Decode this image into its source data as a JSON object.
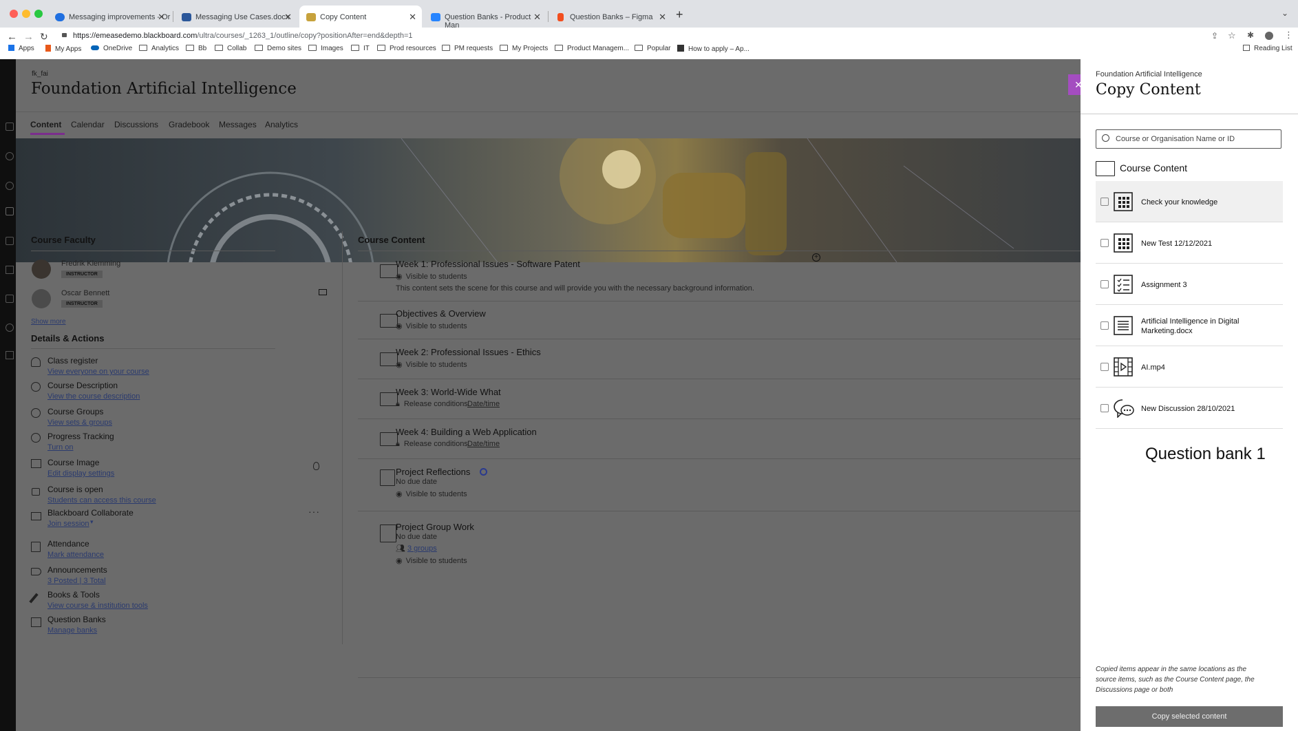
{
  "browser": {
    "tabs": [
      {
        "title": "Messaging improvements - Or",
        "color": "#1f6fe0"
      },
      {
        "title": "Messaging Use Cases.docx",
        "color": "#2b579a"
      },
      {
        "title": "Copy Content",
        "color": "#c7a23c"
      },
      {
        "title": "Question Banks - Product Man",
        "color": "#2684ff"
      },
      {
        "title": "Question Banks – Figma",
        "color": "#f24e1e"
      }
    ],
    "url_host": "https://emeasedemo.blackboard.com",
    "url_path": "/ultra/courses/_1263_1/outline/copy?positionAfter=end&depth=1",
    "bookmarks": [
      "Apps",
      "My Apps",
      "OneDrive",
      "Analytics",
      "Bb",
      "Collab",
      "Demo sites",
      "Images",
      "IT",
      "Prod resources",
      "PM requests",
      "My Projects",
      "Product Managem...",
      "Popular",
      "How to apply – Ap..."
    ],
    "reading_list": "Reading List"
  },
  "course": {
    "code": "fk_fai",
    "title": "Foundation Artificial Intelligence",
    "nav": [
      "Content",
      "Calendar",
      "Discussions",
      "Gradebook",
      "Messages",
      "Analytics"
    ]
  },
  "faculty": {
    "heading": "Course Faculty",
    "members": [
      {
        "name": "Fredrik Klemming",
        "role": "INSTRUCTOR"
      },
      {
        "name": "Oscar Bennett",
        "role": "INSTRUCTOR"
      }
    ],
    "show_more": "Show more"
  },
  "details": {
    "heading": "Details & Actions",
    "items": [
      {
        "label": "Class register",
        "link": "View everyone on your course",
        "icon": "people-icon"
      },
      {
        "label": "Course Description",
        "link": "View the course description",
        "icon": "info-icon"
      },
      {
        "label": "Course Groups",
        "link": "View sets & groups",
        "icon": "groups-icon"
      },
      {
        "label": "Progress Tracking",
        "link": "Turn on",
        "icon": "check-circle-icon"
      },
      {
        "label": "Course Image",
        "link": "Edit display settings",
        "icon": "image-icon"
      },
      {
        "label": "Course is open",
        "link": "Students can access this course",
        "icon": "unlock-icon"
      },
      {
        "label": "Blackboard Collaborate",
        "link": "Join session",
        "icon": "video-icon"
      },
      {
        "label": "Attendance",
        "link": "Mark attendance",
        "icon": "attendance-icon"
      },
      {
        "label": "Announcements",
        "link": "3 Posted | 3 Total",
        "icon": "megaphone-icon"
      },
      {
        "label": "Books & Tools",
        "link": "View course & institution tools",
        "icon": "wrench-icon"
      },
      {
        "label": "Question Banks",
        "link": "Manage banks",
        "icon": "bank-icon"
      }
    ]
  },
  "content": {
    "heading": "Course Content",
    "items": [
      {
        "title": "Week 1: Professional Issues - Software Patent",
        "lines": [
          "Visible to students"
        ],
        "desc": "This content sets the scene for this course and will provide you with the necessary background information."
      },
      {
        "title": "Objectives & Overview",
        "lines": [
          "Visible to students"
        ]
      },
      {
        "title": "Week 2: Professional Issues - Ethics",
        "lines": [
          "Visible to students"
        ]
      },
      {
        "title": "Week 3: World-Wide What",
        "lines": [
          "Release conditions"
        ],
        "link": "Date/time"
      },
      {
        "title": "Week 4: Building a Web Application",
        "lines": [
          "Release conditions"
        ],
        "link": "Date/time"
      },
      {
        "title": "Project Reflections",
        "lines": [
          "No due date",
          "Visible to students"
        ]
      },
      {
        "title": "Project Group Work",
        "lines": [
          "No due date",
          "Visible to students"
        ],
        "link": "3 groups"
      }
    ]
  },
  "panel": {
    "course": "Foundation Artificial Intelligence",
    "title": "Copy Content",
    "search_placeholder": "Course or Organisation Name or ID",
    "folder_label": "Course Content",
    "items": [
      {
        "label": "Check your knowledge",
        "icon": "test-icon"
      },
      {
        "label": "New Test 12/12/2021",
        "icon": "test-icon"
      },
      {
        "label": "Assignment 3",
        "icon": "assignment-icon"
      },
      {
        "label": "Artificial Intelligence in Digital Marketing.docx",
        "icon": "document-icon"
      },
      {
        "label": "AI.mp4",
        "icon": "video-file-icon"
      },
      {
        "label": "New Discussion 28/10/2021",
        "icon": "discussion-icon"
      }
    ],
    "annotation": "Question bank 1",
    "footer_note": "Copied items appear in the same locations as the source items, such as the Course Content page, the Discussions page or both",
    "copy_button": "Copy selected content"
  }
}
